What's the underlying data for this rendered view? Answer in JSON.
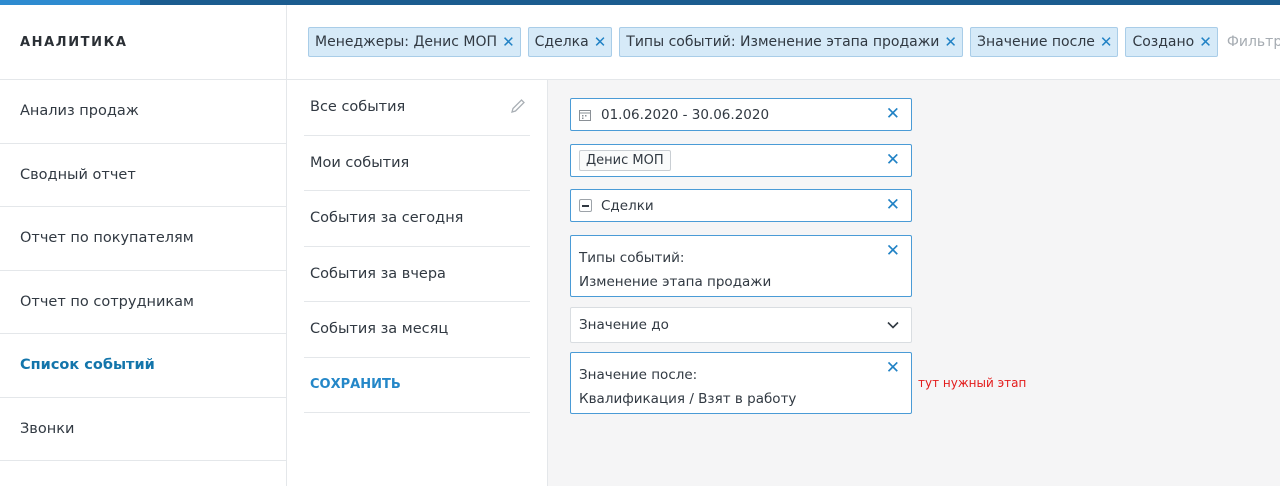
{
  "sidebar": {
    "title": "АНАЛИТИКА",
    "items": [
      {
        "label": "Анализ продаж"
      },
      {
        "label": "Сводный отчет"
      },
      {
        "label": "Отчет по покупателям"
      },
      {
        "label": "Отчет по сотрудникам"
      },
      {
        "label": "Список событий",
        "active": true
      },
      {
        "label": "Звонки"
      }
    ]
  },
  "filters": {
    "chips": [
      {
        "label": "Менеджеры: Денис МОП"
      },
      {
        "label": "Сделка"
      },
      {
        "label": "Типы событий: Изменение этапа продажи"
      },
      {
        "label": "Значение после"
      },
      {
        "label": "Создано"
      }
    ],
    "close_glyph": "✕",
    "placeholder": "Фильтр"
  },
  "presets": {
    "items": [
      {
        "label": "Все события"
      },
      {
        "label": "Мои события"
      },
      {
        "label": "События за сегодня"
      },
      {
        "label": "События за вчера"
      },
      {
        "label": "События за месяц"
      }
    ],
    "save_label": "СОХРАНИТЬ"
  },
  "form": {
    "date_range": "01.06.2020 - 30.06.2020",
    "manager_tag": "Денис МОП",
    "entity": "Сделки",
    "event_types_label": "Типы событий:",
    "event_types_value": "Изменение этапа продажи",
    "value_before_placeholder": "Значение до",
    "value_after_label": "Значение после:",
    "value_after_value": "Квалификация / Взят в работу",
    "close_glyph": "✕"
  },
  "annotation": "тут нужный этап",
  "colors": {
    "accent": "#2182c5",
    "topbar": "#1b5c8f",
    "chip_bg": "#d6eaf8",
    "note_red": "#e31b1b"
  }
}
